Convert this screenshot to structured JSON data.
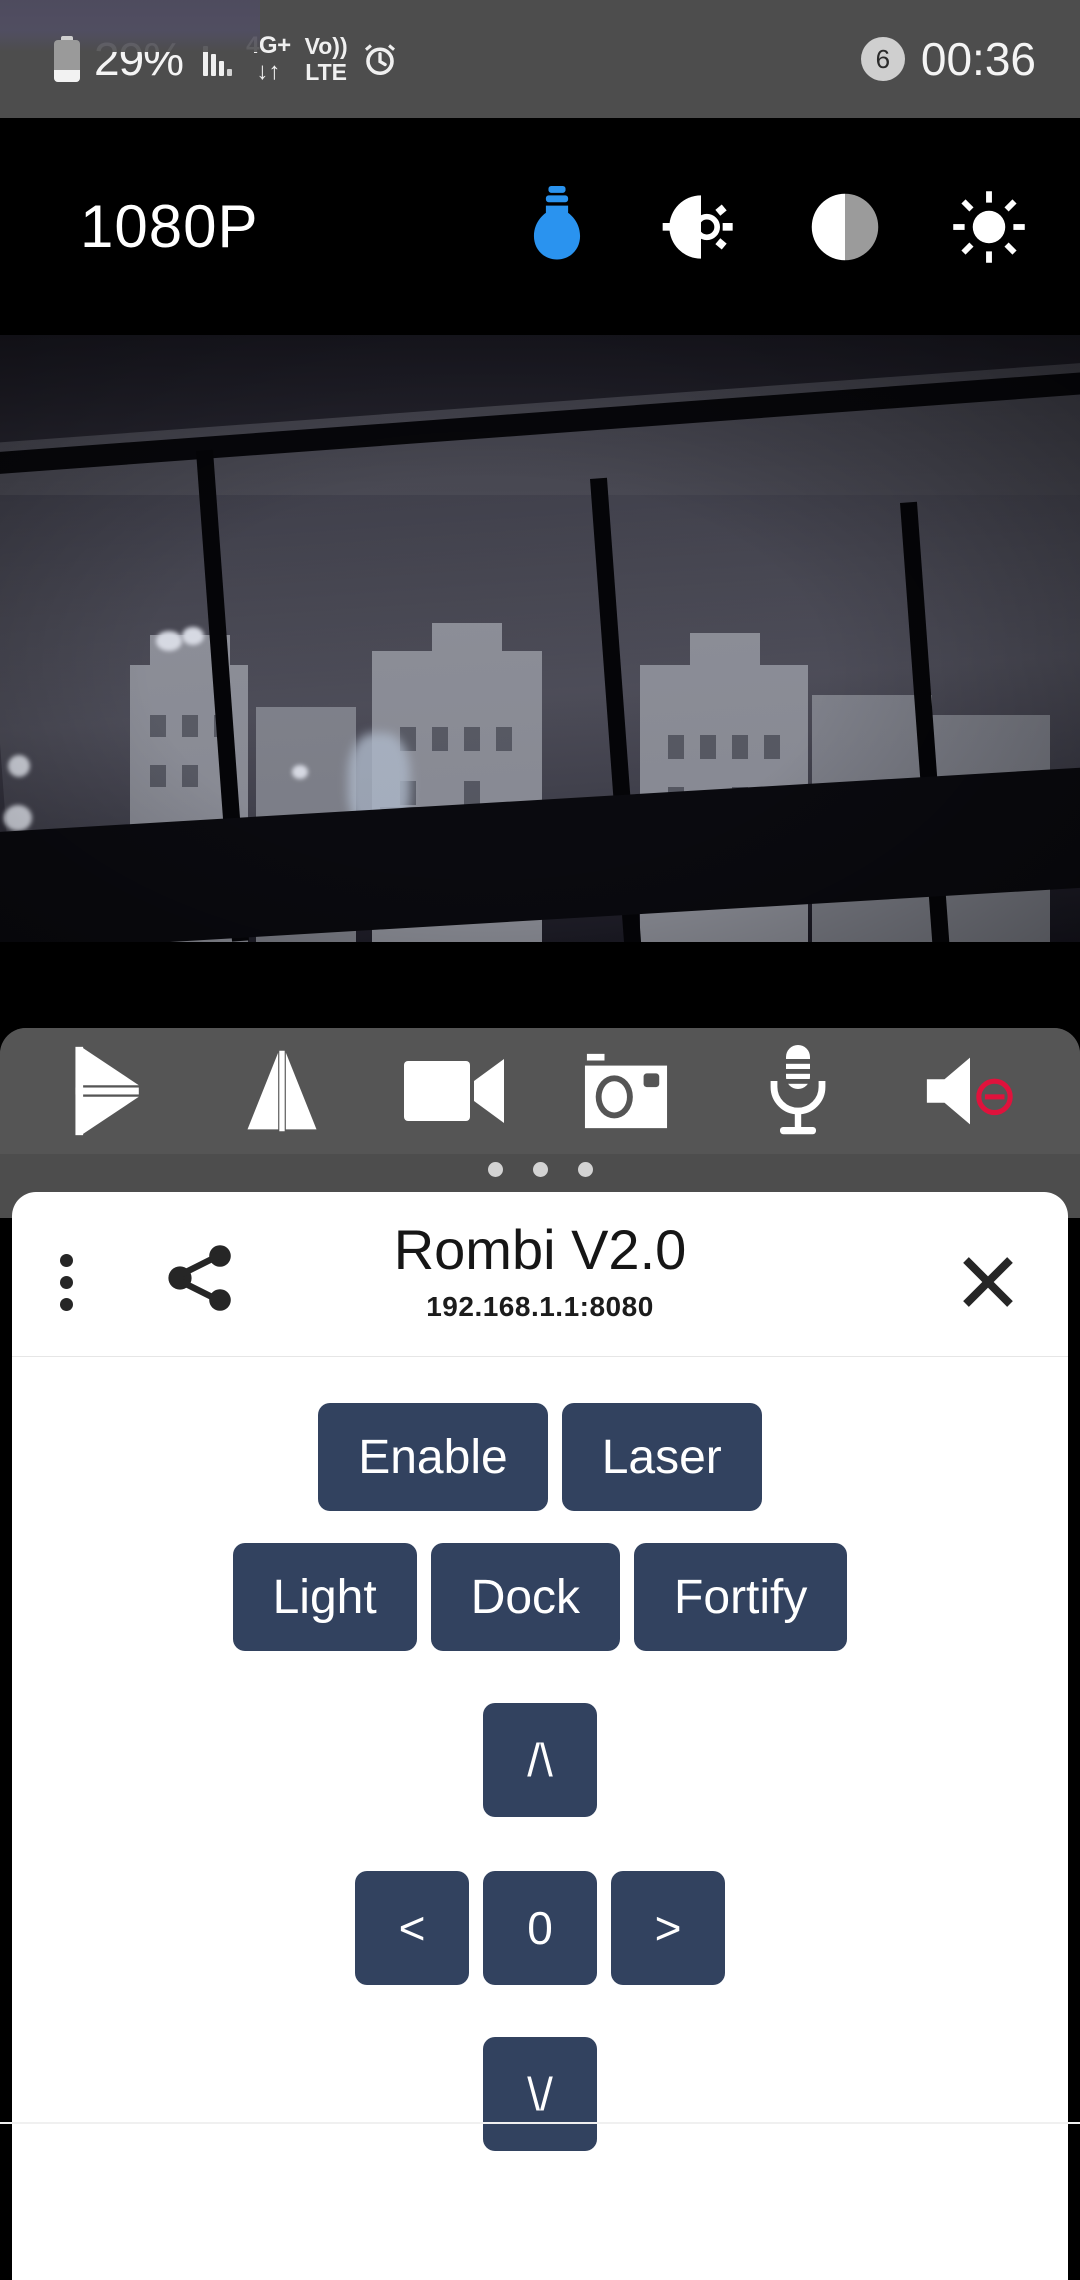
{
  "status_bar": {
    "battery_percent": "29%",
    "battery_level": 29,
    "network_top": "4G+",
    "network_bottom": "↓↑",
    "volte_top": "Vo))",
    "volte_bottom": "LTE",
    "alarm_icon": "alarm-icon",
    "notification_count": "6",
    "time": "00:36"
  },
  "camera_header": {
    "resolution": "1080P",
    "icons": [
      {
        "name": "lightbulb-icon",
        "color": "#2a93ef",
        "active": true
      },
      {
        "name": "exposure-icon",
        "color": "#ffffff",
        "active": false
      },
      {
        "name": "contrast-icon",
        "color": "#ffffff",
        "active": false
      },
      {
        "name": "brightness-icon",
        "color": "#ffffff",
        "active": false
      }
    ]
  },
  "video_feed": {
    "description": "night-time camera view of buildings through a window"
  },
  "control_toolbar": {
    "buttons": [
      {
        "name": "flip-vertical-icon",
        "label": "Flip Vertical"
      },
      {
        "name": "flip-horizontal-icon",
        "label": "Mirror"
      },
      {
        "name": "video-record-icon",
        "label": "Record Video"
      },
      {
        "name": "photo-camera-icon",
        "label": "Take Photo"
      },
      {
        "name": "microphone-icon",
        "label": "Microphone"
      },
      {
        "name": "speaker-muted-icon",
        "label": "Speaker Muted"
      }
    ],
    "page_dots": 3,
    "active_dot": 1
  },
  "sheet": {
    "menu_icon": "kebab-menu-icon",
    "share_icon": "share-icon",
    "close_icon": "close-icon",
    "title": "Rombi V2.0",
    "subtitle": "192.168.1.1:8080",
    "row1": [
      {
        "label": "Enable",
        "name": "enable-button"
      },
      {
        "label": "Laser",
        "name": "laser-button"
      }
    ],
    "row2": [
      {
        "label": "Light",
        "name": "light-button"
      },
      {
        "label": "Dock",
        "name": "dock-button"
      },
      {
        "label": "Fortify",
        "name": "fortify-button"
      }
    ],
    "dpad": {
      "up": "/\\",
      "left": "<",
      "center": "0",
      "right": ">",
      "down": "\\/"
    }
  },
  "colors": {
    "button_navy": "#32425f",
    "status_bar_gray": "#4d4d4d",
    "toolbar_gray": "#555555",
    "accent_blue": "#2a93ef",
    "mute_red": "#e0123c"
  }
}
